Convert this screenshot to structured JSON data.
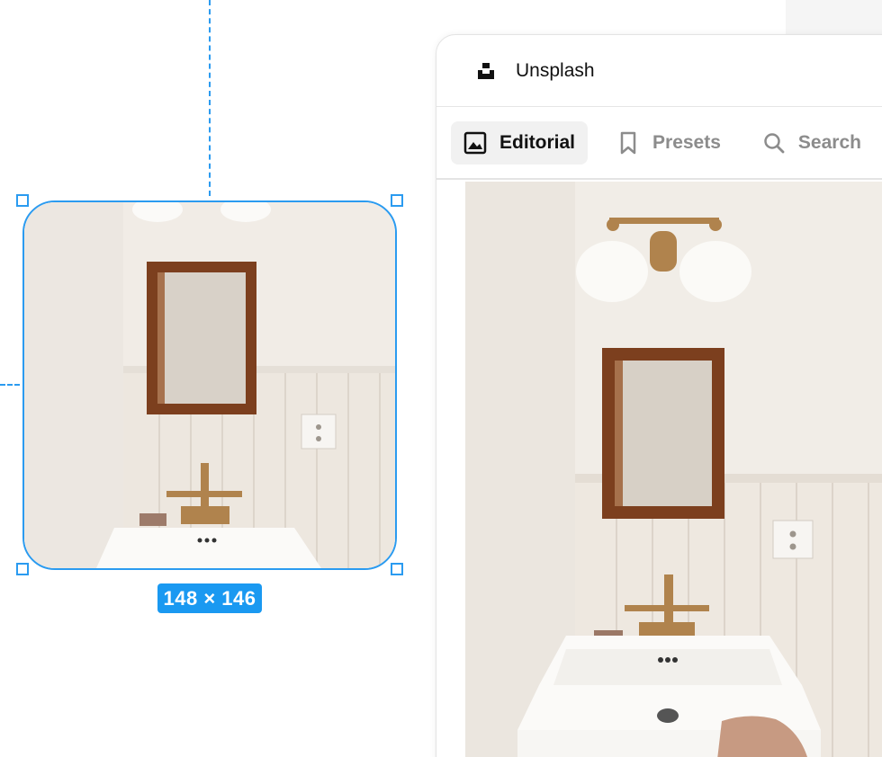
{
  "canvas": {
    "selection_size_label": "148 × 146",
    "colors": {
      "selection": "#2b9bf0",
      "badge": "#1a99f1"
    }
  },
  "plugin": {
    "app_name": "Unsplash",
    "logo_icon": "unsplash-logo-icon",
    "tabs": [
      {
        "label": "Editorial",
        "icon": "image-icon",
        "active": true
      },
      {
        "label": "Presets",
        "icon": "bookmark-icon",
        "active": false
      },
      {
        "label": "Search",
        "icon": "search-icon",
        "active": false
      }
    ]
  },
  "image": {
    "subject": "bathroom-sink-mirror-photo"
  }
}
